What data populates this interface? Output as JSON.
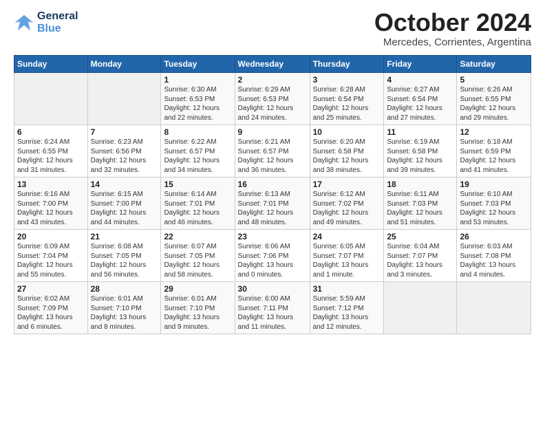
{
  "logo": {
    "line1": "General",
    "line2": "Blue"
  },
  "title": "October 2024",
  "subtitle": "Mercedes, Corrientes, Argentina",
  "days_header": [
    "Sunday",
    "Monday",
    "Tuesday",
    "Wednesday",
    "Thursday",
    "Friday",
    "Saturday"
  ],
  "weeks": [
    [
      {
        "day": "",
        "info": ""
      },
      {
        "day": "",
        "info": ""
      },
      {
        "day": "1",
        "info": "Sunrise: 6:30 AM\nSunset: 6:53 PM\nDaylight: 12 hours\nand 22 minutes."
      },
      {
        "day": "2",
        "info": "Sunrise: 6:29 AM\nSunset: 6:53 PM\nDaylight: 12 hours\nand 24 minutes."
      },
      {
        "day": "3",
        "info": "Sunrise: 6:28 AM\nSunset: 6:54 PM\nDaylight: 12 hours\nand 25 minutes."
      },
      {
        "day": "4",
        "info": "Sunrise: 6:27 AM\nSunset: 6:54 PM\nDaylight: 12 hours\nand 27 minutes."
      },
      {
        "day": "5",
        "info": "Sunrise: 6:26 AM\nSunset: 6:55 PM\nDaylight: 12 hours\nand 29 minutes."
      }
    ],
    [
      {
        "day": "6",
        "info": "Sunrise: 6:24 AM\nSunset: 6:55 PM\nDaylight: 12 hours\nand 31 minutes."
      },
      {
        "day": "7",
        "info": "Sunrise: 6:23 AM\nSunset: 6:56 PM\nDaylight: 12 hours\nand 32 minutes."
      },
      {
        "day": "8",
        "info": "Sunrise: 6:22 AM\nSunset: 6:57 PM\nDaylight: 12 hours\nand 34 minutes."
      },
      {
        "day": "9",
        "info": "Sunrise: 6:21 AM\nSunset: 6:57 PM\nDaylight: 12 hours\nand 36 minutes."
      },
      {
        "day": "10",
        "info": "Sunrise: 6:20 AM\nSunset: 6:58 PM\nDaylight: 12 hours\nand 38 minutes."
      },
      {
        "day": "11",
        "info": "Sunrise: 6:19 AM\nSunset: 6:58 PM\nDaylight: 12 hours\nand 39 minutes."
      },
      {
        "day": "12",
        "info": "Sunrise: 6:18 AM\nSunset: 6:59 PM\nDaylight: 12 hours\nand 41 minutes."
      }
    ],
    [
      {
        "day": "13",
        "info": "Sunrise: 6:16 AM\nSunset: 7:00 PM\nDaylight: 12 hours\nand 43 minutes."
      },
      {
        "day": "14",
        "info": "Sunrise: 6:15 AM\nSunset: 7:00 PM\nDaylight: 12 hours\nand 44 minutes."
      },
      {
        "day": "15",
        "info": "Sunrise: 6:14 AM\nSunset: 7:01 PM\nDaylight: 12 hours\nand 46 minutes."
      },
      {
        "day": "16",
        "info": "Sunrise: 6:13 AM\nSunset: 7:01 PM\nDaylight: 12 hours\nand 48 minutes."
      },
      {
        "day": "17",
        "info": "Sunrise: 6:12 AM\nSunset: 7:02 PM\nDaylight: 12 hours\nand 49 minutes."
      },
      {
        "day": "18",
        "info": "Sunrise: 6:11 AM\nSunset: 7:03 PM\nDaylight: 12 hours\nand 51 minutes."
      },
      {
        "day": "19",
        "info": "Sunrise: 6:10 AM\nSunset: 7:03 PM\nDaylight: 12 hours\nand 53 minutes."
      }
    ],
    [
      {
        "day": "20",
        "info": "Sunrise: 6:09 AM\nSunset: 7:04 PM\nDaylight: 12 hours\nand 55 minutes."
      },
      {
        "day": "21",
        "info": "Sunrise: 6:08 AM\nSunset: 7:05 PM\nDaylight: 12 hours\nand 56 minutes."
      },
      {
        "day": "22",
        "info": "Sunrise: 6:07 AM\nSunset: 7:05 PM\nDaylight: 12 hours\nand 58 minutes."
      },
      {
        "day": "23",
        "info": "Sunrise: 6:06 AM\nSunset: 7:06 PM\nDaylight: 13 hours\nand 0 minutes."
      },
      {
        "day": "24",
        "info": "Sunrise: 6:05 AM\nSunset: 7:07 PM\nDaylight: 13 hours\nand 1 minute."
      },
      {
        "day": "25",
        "info": "Sunrise: 6:04 AM\nSunset: 7:07 PM\nDaylight: 13 hours\nand 3 minutes."
      },
      {
        "day": "26",
        "info": "Sunrise: 6:03 AM\nSunset: 7:08 PM\nDaylight: 13 hours\nand 4 minutes."
      }
    ],
    [
      {
        "day": "27",
        "info": "Sunrise: 6:02 AM\nSunset: 7:09 PM\nDaylight: 13 hours\nand 6 minutes."
      },
      {
        "day": "28",
        "info": "Sunrise: 6:01 AM\nSunset: 7:10 PM\nDaylight: 13 hours\nand 8 minutes."
      },
      {
        "day": "29",
        "info": "Sunrise: 6:01 AM\nSunset: 7:10 PM\nDaylight: 13 hours\nand 9 minutes."
      },
      {
        "day": "30",
        "info": "Sunrise: 6:00 AM\nSunset: 7:11 PM\nDaylight: 13 hours\nand 11 minutes."
      },
      {
        "day": "31",
        "info": "Sunrise: 5:59 AM\nSunset: 7:12 PM\nDaylight: 13 hours\nand 12 minutes."
      },
      {
        "day": "",
        "info": ""
      },
      {
        "day": "",
        "info": ""
      }
    ]
  ]
}
